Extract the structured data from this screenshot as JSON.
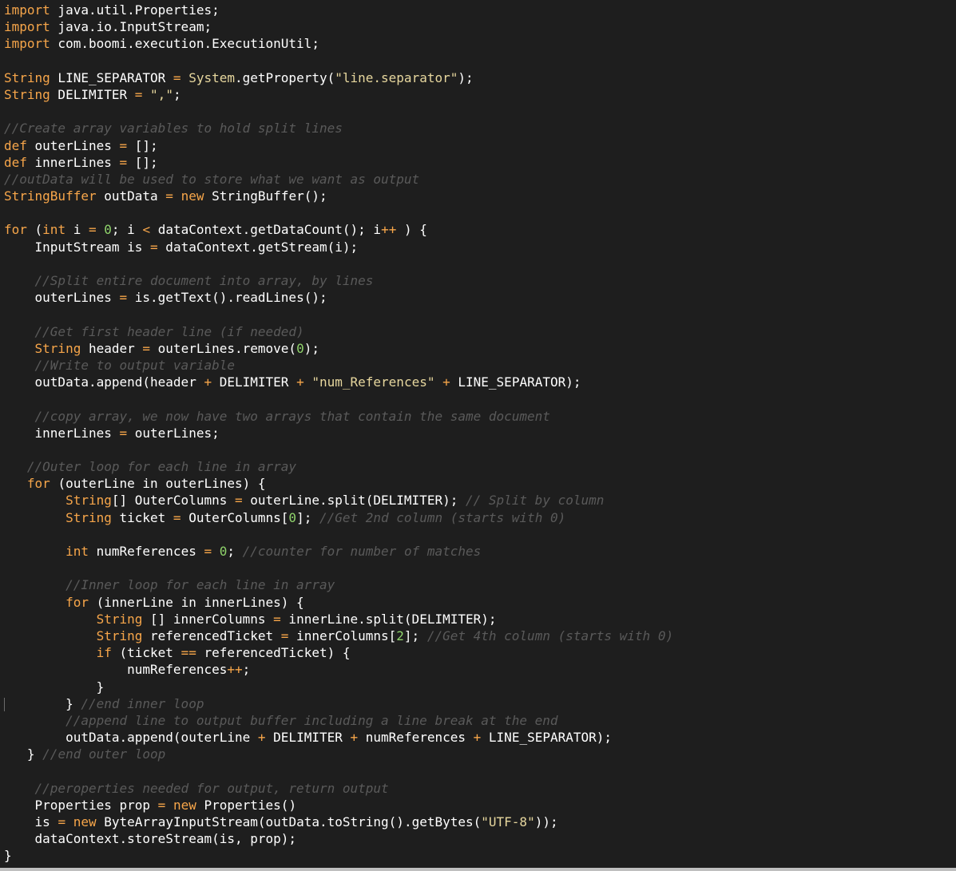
{
  "editor": {
    "theme": {
      "background": "#1e1e1e",
      "keyword": "#f7a64a",
      "type": "#f7a64a",
      "string": "#e7d79e",
      "number": "#8fd36b",
      "comment": "#5a5a5a",
      "text": "#ffffff"
    },
    "lines": [
      [
        {
          "t": "kw",
          "v": "import"
        },
        {
          "t": "id",
          "v": " java.util.Properties;"
        }
      ],
      [
        {
          "t": "kw",
          "v": "import"
        },
        {
          "t": "id",
          "v": " java.io.InputStream;"
        }
      ],
      [
        {
          "t": "kw",
          "v": "import"
        },
        {
          "t": "id",
          "v": " com.boomi.execution.ExecutionUtil;"
        }
      ],
      [],
      [
        {
          "t": "ty",
          "v": "String"
        },
        {
          "t": "id",
          "v": " LINE_SEPARATOR "
        },
        {
          "t": "op",
          "v": "="
        },
        {
          "t": "id",
          "v": " "
        },
        {
          "t": "sy",
          "v": "System"
        },
        {
          "t": "id",
          "v": ".getProperty("
        },
        {
          "t": "str",
          "v": "\"line.separator\""
        },
        {
          "t": "id",
          "v": ");"
        }
      ],
      [
        {
          "t": "ty",
          "v": "String"
        },
        {
          "t": "id",
          "v": " DELIMITER "
        },
        {
          "t": "op",
          "v": "="
        },
        {
          "t": "id",
          "v": " "
        },
        {
          "t": "str",
          "v": "\",\""
        },
        {
          "t": "id",
          "v": ";"
        }
      ],
      [],
      [
        {
          "t": "cm",
          "v": "//Create array variables to hold split lines"
        }
      ],
      [
        {
          "t": "kw",
          "v": "def"
        },
        {
          "t": "id",
          "v": " outerLines "
        },
        {
          "t": "op",
          "v": "="
        },
        {
          "t": "id",
          "v": " [];"
        }
      ],
      [
        {
          "t": "kw",
          "v": "def"
        },
        {
          "t": "id",
          "v": " innerLines "
        },
        {
          "t": "op",
          "v": "="
        },
        {
          "t": "id",
          "v": " [];"
        }
      ],
      [
        {
          "t": "cm",
          "v": "//outData will be used to store what we want as output"
        }
      ],
      [
        {
          "t": "ty",
          "v": "StringBuffer"
        },
        {
          "t": "id",
          "v": " outData "
        },
        {
          "t": "op",
          "v": "="
        },
        {
          "t": "id",
          "v": " "
        },
        {
          "t": "kw",
          "v": "new"
        },
        {
          "t": "id",
          "v": " StringBuffer();"
        }
      ],
      [],
      [
        {
          "t": "kw",
          "v": "for"
        },
        {
          "t": "id",
          "v": " ("
        },
        {
          "t": "kw",
          "v": "int"
        },
        {
          "t": "id",
          "v": " i "
        },
        {
          "t": "op",
          "v": "="
        },
        {
          "t": "id",
          "v": " "
        },
        {
          "t": "num",
          "v": "0"
        },
        {
          "t": "id",
          "v": "; i "
        },
        {
          "t": "op",
          "v": "<"
        },
        {
          "t": "id",
          "v": " dataContext.getDataCount(); i"
        },
        {
          "t": "op",
          "v": "++"
        },
        {
          "t": "id",
          "v": " ) {"
        }
      ],
      [
        {
          "t": "id",
          "v": "    InputStream is "
        },
        {
          "t": "op",
          "v": "="
        },
        {
          "t": "id",
          "v": " dataContext.getStream(i);"
        }
      ],
      [],
      [
        {
          "t": "id",
          "v": "    "
        },
        {
          "t": "cm",
          "v": "//Split entire document into array, by lines"
        }
      ],
      [
        {
          "t": "id",
          "v": "    outerLines "
        },
        {
          "t": "op",
          "v": "="
        },
        {
          "t": "id",
          "v": " is.getText().readLines();"
        }
      ],
      [],
      [
        {
          "t": "id",
          "v": "    "
        },
        {
          "t": "cm",
          "v": "//Get first header line (if needed)"
        }
      ],
      [
        {
          "t": "id",
          "v": "    "
        },
        {
          "t": "ty",
          "v": "String"
        },
        {
          "t": "id",
          "v": " header "
        },
        {
          "t": "op",
          "v": "="
        },
        {
          "t": "id",
          "v": " outerLines.remove("
        },
        {
          "t": "num",
          "v": "0"
        },
        {
          "t": "id",
          "v": ");"
        }
      ],
      [
        {
          "t": "id",
          "v": "    "
        },
        {
          "t": "cm",
          "v": "//Write to output variable"
        }
      ],
      [
        {
          "t": "id",
          "v": "    outData.append(header "
        },
        {
          "t": "op",
          "v": "+"
        },
        {
          "t": "id",
          "v": " DELIMITER "
        },
        {
          "t": "op",
          "v": "+"
        },
        {
          "t": "id",
          "v": " "
        },
        {
          "t": "str",
          "v": "\"num_References\""
        },
        {
          "t": "id",
          "v": " "
        },
        {
          "t": "op",
          "v": "+"
        },
        {
          "t": "id",
          "v": " LINE_SEPARATOR);"
        }
      ],
      [],
      [
        {
          "t": "id",
          "v": "    "
        },
        {
          "t": "cm",
          "v": "//copy array, we now have two arrays that contain the same document"
        }
      ],
      [
        {
          "t": "id",
          "v": "    innerLines "
        },
        {
          "t": "op",
          "v": "="
        },
        {
          "t": "id",
          "v": " outerLines;"
        }
      ],
      [],
      [
        {
          "t": "id",
          "v": "   "
        },
        {
          "t": "cm",
          "v": "//Outer loop for each line in array"
        }
      ],
      [
        {
          "t": "id",
          "v": "   "
        },
        {
          "t": "kw",
          "v": "for"
        },
        {
          "t": "id",
          "v": " (outerLine in outerLines) {"
        }
      ],
      [
        {
          "t": "id",
          "v": "        "
        },
        {
          "t": "ty",
          "v": "String"
        },
        {
          "t": "id",
          "v": "[] OuterColumns "
        },
        {
          "t": "op",
          "v": "="
        },
        {
          "t": "id",
          "v": " outerLine.split(DELIMITER); "
        },
        {
          "t": "cm",
          "v": "// Split by column"
        }
      ],
      [
        {
          "t": "id",
          "v": "        "
        },
        {
          "t": "ty",
          "v": "String"
        },
        {
          "t": "id",
          "v": " ticket "
        },
        {
          "t": "op",
          "v": "="
        },
        {
          "t": "id",
          "v": " OuterColumns["
        },
        {
          "t": "num",
          "v": "0"
        },
        {
          "t": "id",
          "v": "]; "
        },
        {
          "t": "cm",
          "v": "//Get 2nd column (starts with 0)"
        }
      ],
      [],
      [
        {
          "t": "id",
          "v": "        "
        },
        {
          "t": "kw",
          "v": "int"
        },
        {
          "t": "id",
          "v": " numReferences "
        },
        {
          "t": "op",
          "v": "="
        },
        {
          "t": "id",
          "v": " "
        },
        {
          "t": "num",
          "v": "0"
        },
        {
          "t": "id",
          "v": "; "
        },
        {
          "t": "cm",
          "v": "//counter for number of matches"
        }
      ],
      [],
      [
        {
          "t": "id",
          "v": "        "
        },
        {
          "t": "cm",
          "v": "//Inner loop for each line in array"
        }
      ],
      [
        {
          "t": "id",
          "v": "        "
        },
        {
          "t": "kw",
          "v": "for"
        },
        {
          "t": "id",
          "v": " (innerLine in innerLines) {"
        }
      ],
      [
        {
          "t": "id",
          "v": "            "
        },
        {
          "t": "ty",
          "v": "String"
        },
        {
          "t": "id",
          "v": " [] innerColumns "
        },
        {
          "t": "op",
          "v": "="
        },
        {
          "t": "id",
          "v": " innerLine.split(DELIMITER);"
        }
      ],
      [
        {
          "t": "id",
          "v": "            "
        },
        {
          "t": "ty",
          "v": "String"
        },
        {
          "t": "id",
          "v": " referencedTicket "
        },
        {
          "t": "op",
          "v": "="
        },
        {
          "t": "id",
          "v": " innerColumns["
        },
        {
          "t": "num",
          "v": "2"
        },
        {
          "t": "id",
          "v": "]; "
        },
        {
          "t": "cm",
          "v": "//Get 4th column (starts with 0)"
        }
      ],
      [
        {
          "t": "id",
          "v": "            "
        },
        {
          "t": "kw",
          "v": "if"
        },
        {
          "t": "id",
          "v": " (ticket "
        },
        {
          "t": "op",
          "v": "=="
        },
        {
          "t": "id",
          "v": " referencedTicket) {"
        }
      ],
      [
        {
          "t": "id",
          "v": "                numReferences"
        },
        {
          "t": "op",
          "v": "++"
        },
        {
          "t": "id",
          "v": ";"
        }
      ],
      [
        {
          "t": "id",
          "v": "            }"
        }
      ],
      [
        {
          "t": "id",
          "v": "        } "
        },
        {
          "t": "cm",
          "v": "//end inner loop"
        }
      ],
      [
        {
          "t": "id",
          "v": "        "
        },
        {
          "t": "cm",
          "v": "//append line to output buffer including a line break at the end"
        }
      ],
      [
        {
          "t": "id",
          "v": "        outData.append(outerLine "
        },
        {
          "t": "op",
          "v": "+"
        },
        {
          "t": "id",
          "v": " DELIMITER "
        },
        {
          "t": "op",
          "v": "+"
        },
        {
          "t": "id",
          "v": " numReferences "
        },
        {
          "t": "op",
          "v": "+"
        },
        {
          "t": "id",
          "v": " LINE_SEPARATOR);"
        }
      ],
      [
        {
          "t": "id",
          "v": "   } "
        },
        {
          "t": "cm",
          "v": "//end outer loop"
        }
      ],
      [],
      [
        {
          "t": "id",
          "v": "    "
        },
        {
          "t": "cm",
          "v": "//peroperties needed for output, return output"
        }
      ],
      [
        {
          "t": "id",
          "v": "    Properties prop "
        },
        {
          "t": "op",
          "v": "="
        },
        {
          "t": "id",
          "v": " "
        },
        {
          "t": "kw",
          "v": "new"
        },
        {
          "t": "id",
          "v": " Properties()"
        }
      ],
      [
        {
          "t": "id",
          "v": "    is "
        },
        {
          "t": "op",
          "v": "="
        },
        {
          "t": "id",
          "v": " "
        },
        {
          "t": "kw",
          "v": "new"
        },
        {
          "t": "id",
          "v": " ByteArrayInputStream(outData.toString().getBytes("
        },
        {
          "t": "str",
          "v": "\"UTF-8\""
        },
        {
          "t": "id",
          "v": "));"
        }
      ],
      [
        {
          "t": "id",
          "v": "    dataContext.storeStream(is, prop);"
        }
      ],
      [
        {
          "t": "id",
          "v": "}"
        }
      ]
    ]
  }
}
